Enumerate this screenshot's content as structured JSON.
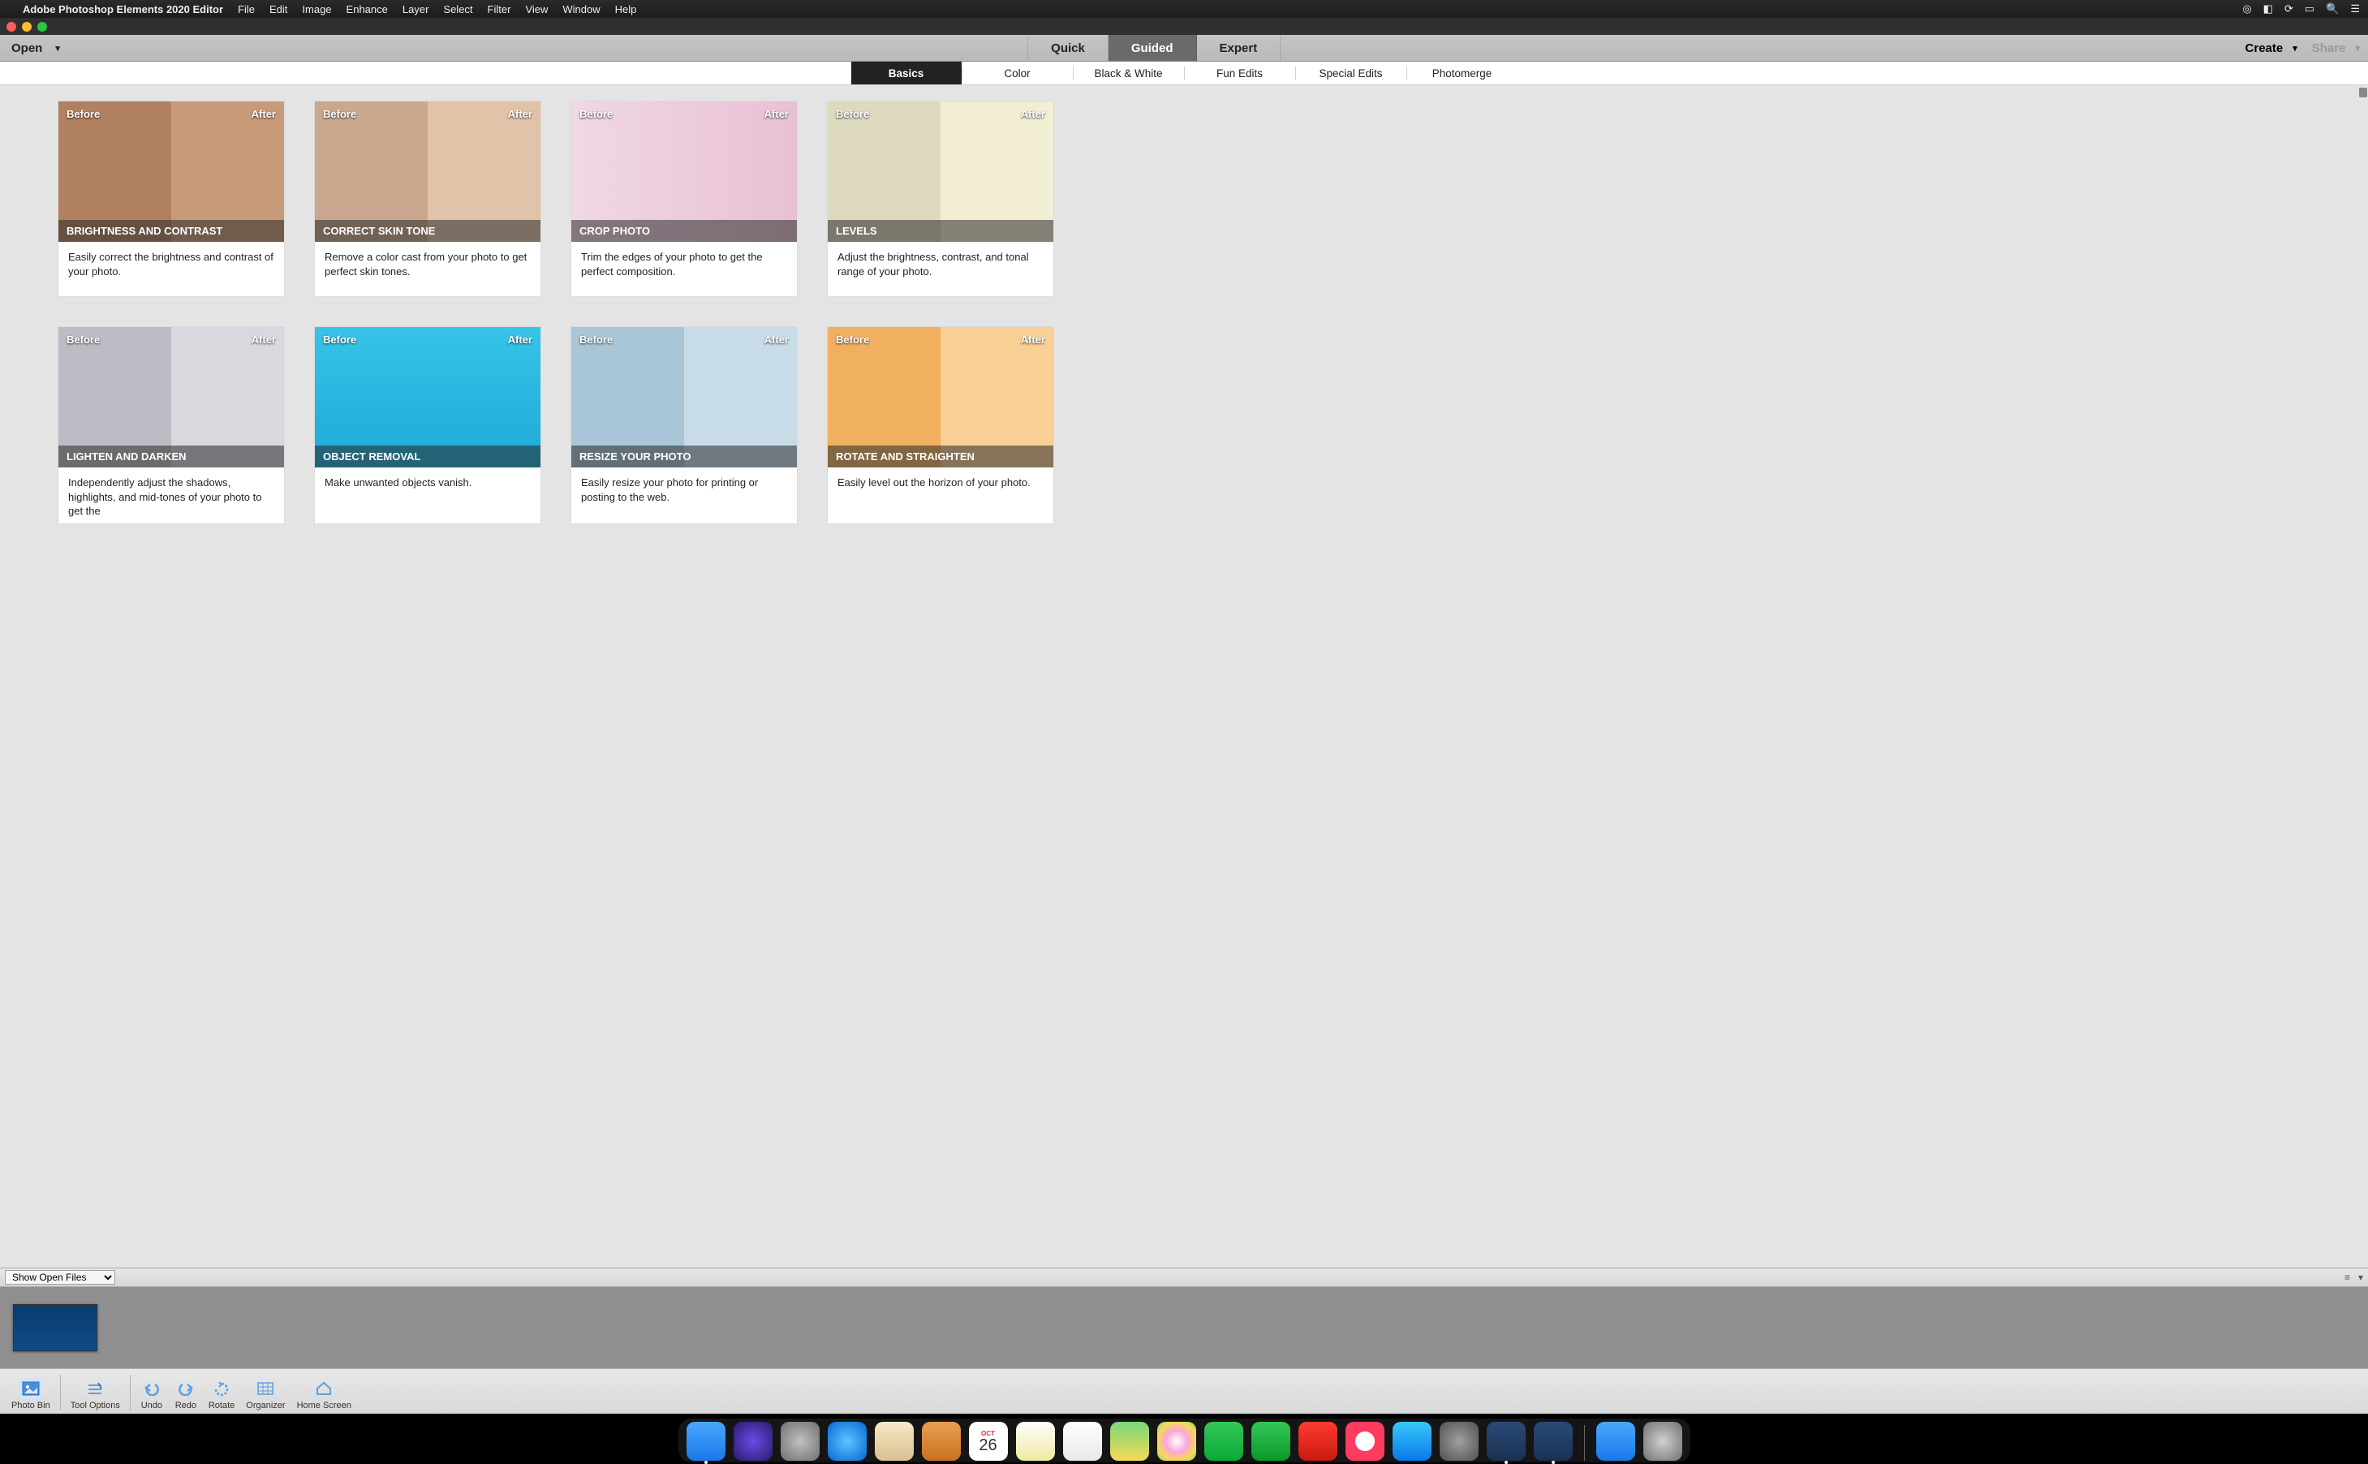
{
  "menubar": {
    "app_name": "Adobe Photoshop Elements 2020 Editor",
    "items": [
      "File",
      "Edit",
      "Image",
      "Enhance",
      "Layer",
      "Select",
      "Filter",
      "View",
      "Window",
      "Help"
    ]
  },
  "modebar": {
    "open": "Open",
    "tabs": [
      "Quick",
      "Guided",
      "Expert"
    ],
    "active": "Guided",
    "create": "Create",
    "share": "Share"
  },
  "categories": {
    "items": [
      "Basics",
      "Color",
      "Black & White",
      "Fun Edits",
      "Special Edits",
      "Photomerge"
    ],
    "active": "Basics"
  },
  "labels": {
    "before": "Before",
    "after": "After"
  },
  "cards": [
    {
      "title": "BRIGHTNESS AND CONTRAST",
      "desc": "Easily correct the brightness and contrast of your photo."
    },
    {
      "title": "CORRECT SKIN TONE",
      "desc": "Remove a color cast from your photo to get perfect skin tones."
    },
    {
      "title": "CROP PHOTO",
      "desc": "Trim the edges of your photo to get the perfect composition."
    },
    {
      "title": "LEVELS",
      "desc": "Adjust the brightness, contrast, and tonal range of your photo."
    },
    {
      "title": "LIGHTEN AND DARKEN",
      "desc": "Independently adjust the shadows, highlights, and mid-tones of your photo to get the"
    },
    {
      "title": "OBJECT REMOVAL",
      "desc": "Make unwanted objects vanish."
    },
    {
      "title": "RESIZE YOUR PHOTO",
      "desc": "Easily resize your photo for printing or posting to the web."
    },
    {
      "title": "ROTATE AND STRAIGHTEN",
      "desc": "Easily level out the horizon of your photo."
    }
  ],
  "binbar": {
    "dropdown": "Show Open Files"
  },
  "tools": [
    {
      "id": "photo-bin",
      "label": "Photo Bin"
    },
    {
      "id": "tool-options",
      "label": "Tool Options"
    },
    {
      "id": "undo",
      "label": "Undo"
    },
    {
      "id": "redo",
      "label": "Redo"
    },
    {
      "id": "rotate",
      "label": "Rotate"
    },
    {
      "id": "organizer",
      "label": "Organizer"
    },
    {
      "id": "home-screen",
      "label": "Home Screen"
    }
  ],
  "dock": {
    "apps": [
      "finder",
      "siri",
      "launchpad",
      "safari",
      "mail",
      "contacts",
      "calendar",
      "notes",
      "reminders",
      "maps",
      "photos",
      "messages",
      "facetime",
      "news",
      "music",
      "appstore",
      "settings",
      "pse-organizer",
      "pse-editor"
    ],
    "calendar_day": "26",
    "calendar_month": "OCT"
  }
}
